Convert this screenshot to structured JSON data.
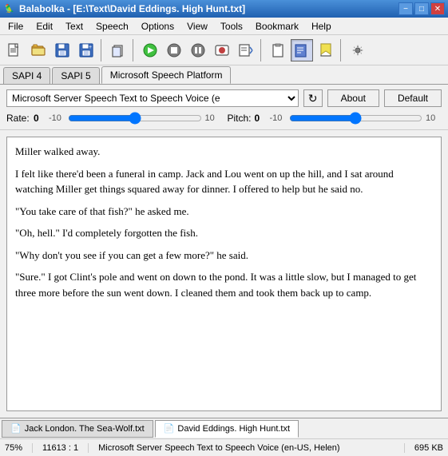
{
  "titlebar": {
    "icon": "🦜",
    "title": "Balabolka - [E:\\Text\\David Eddings. High Hunt.txt]",
    "minimize": "−",
    "maximize": "□",
    "close": "✕"
  },
  "menubar": {
    "items": [
      "File",
      "Edit",
      "Text",
      "Speech",
      "Options",
      "View",
      "Tools",
      "Bookmark",
      "Help"
    ]
  },
  "toolbar": {
    "buttons": [
      {
        "name": "new",
        "icon": "📄"
      },
      {
        "name": "open",
        "icon": "📂"
      },
      {
        "name": "save",
        "icon": "💾"
      },
      {
        "name": "save-as",
        "icon": "💾"
      },
      {
        "name": "copy-paste",
        "icon": "📋"
      },
      {
        "name": "play",
        "icon": "▶"
      },
      {
        "name": "stop",
        "icon": "⏹"
      },
      {
        "name": "pause",
        "icon": "⏸"
      },
      {
        "name": "record",
        "icon": "⏺"
      },
      {
        "name": "tts-file",
        "icon": "🔊"
      },
      {
        "name": "clipboard",
        "icon": "📋"
      },
      {
        "name": "tts-active",
        "icon": "📝"
      },
      {
        "name": "bookmark",
        "icon": "🔖"
      },
      {
        "name": "settings",
        "icon": "⚙"
      }
    ]
  },
  "tabs": {
    "items": [
      "SAPI 4",
      "SAPI 5",
      "Microsoft Speech Platform"
    ],
    "active": 2
  },
  "voice": {
    "select_value": "Microsoft Server Speech Text to Speech Voice (e",
    "select_placeholder": "Microsoft Server Speech Text to Speech Voice (e",
    "refresh_icon": "↻",
    "about_label": "About",
    "default_label": "Default"
  },
  "sliders": {
    "rate": {
      "label": "Rate:",
      "value": "0",
      "min": "-10",
      "max": "10",
      "current": 0
    },
    "pitch": {
      "label": "Pitch:",
      "value": "0",
      "min": "-10",
      "max": "10",
      "current": 0
    }
  },
  "text_content": {
    "paragraphs": [
      "Miller walked away.",
      "I felt like there'd been a funeral in camp. Jack and Lou went on up the hill, and I sat around watching Miller get things squared away for dinner. I offered to help but he said no.",
      "\"You take care of that fish?\" he asked me.",
      "\"Oh, hell.\" I'd completely forgotten the fish.",
      "\"Why don't you see if you can get a few more?\" he said.",
      "\"Sure.\" I got Clint's pole and went on down to the pond. It was a little slow, but I managed to get three more before the sun went down. I cleaned them and took them back up to camp."
    ]
  },
  "doc_tabs": {
    "items": [
      {
        "name": "Jack London. The Sea-Wolf.txt",
        "active": false
      },
      {
        "name": "David Eddings. High Hunt.txt",
        "active": true
      }
    ],
    "doc_icon": "📄"
  },
  "statusbar": {
    "zoom": "75%",
    "position": "11613 : 1",
    "voice": "Microsoft Server Speech Text to Speech Voice (en-US, Helen)",
    "size": "695 KB"
  }
}
